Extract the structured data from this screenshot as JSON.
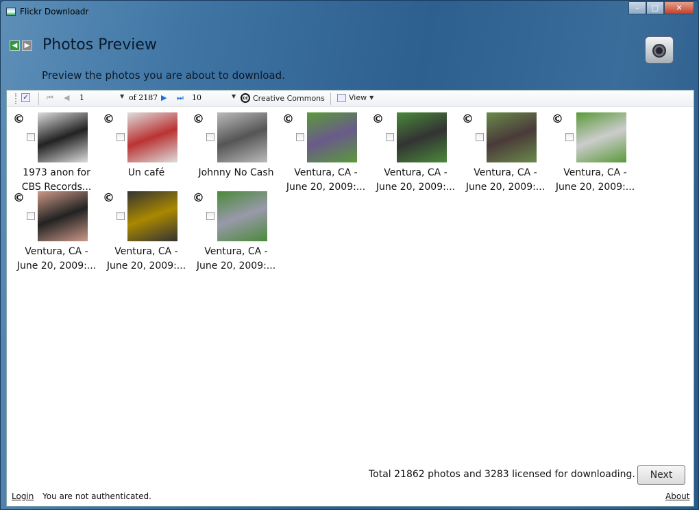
{
  "window": {
    "title": "Flickr Downloadr",
    "min": "–",
    "max": "□",
    "close": "✕"
  },
  "header": {
    "title": "Photos Preview",
    "subtitle": "Preview the photos you are about to download."
  },
  "toolbar": {
    "page": "1",
    "of_label": "of 2187",
    "per_page": "10",
    "license_label": "Creative Commons",
    "view_label": "View",
    "cc_glyph": "cc"
  },
  "photos": [
    {
      "caption": [
        "1973 anon for",
        "CBS Records..."
      ],
      "colors": [
        "#222",
        "#ddd"
      ],
      "license": "©"
    },
    {
      "caption": [
        "Un café",
        ""
      ],
      "colors": [
        "#b33",
        "#ddd"
      ],
      "license": "©"
    },
    {
      "caption": [
        "Johnny No Cash",
        ""
      ],
      "colors": [
        "#555",
        "#bbb"
      ],
      "license": "©"
    },
    {
      "caption": [
        "Ventura, CA -",
        "June 20, 2009:..."
      ],
      "colors": [
        "#6a5a8a",
        "#5a9a3a"
      ],
      "license": "©"
    },
    {
      "caption": [
        "Ventura, CA -",
        "June 20, 2009:..."
      ],
      "colors": [
        "#333",
        "#4a8a3a"
      ],
      "license": "©"
    },
    {
      "caption": [
        "Ventura, CA -",
        "June 20, 2009:..."
      ],
      "colors": [
        "#4a3a3a",
        "#6a8a4a"
      ],
      "license": "©"
    },
    {
      "caption": [
        "Ventura, CA -",
        "June 20, 2009:..."
      ],
      "colors": [
        "#ccc",
        "#5a9a3a"
      ],
      "license": "©"
    },
    {
      "caption": [
        "Ventura, CA -",
        "June 20, 2009:..."
      ],
      "colors": [
        "#222",
        "#c98"
      ],
      "license": "©"
    },
    {
      "caption": [
        "Ventura, CA -",
        "June 20, 2009:..."
      ],
      "colors": [
        "#a80",
        "#333"
      ],
      "license": "©"
    },
    {
      "caption": [
        "Ventura, CA -",
        "June 20, 2009:..."
      ],
      "colors": [
        "#99a",
        "#4a8a3a"
      ],
      "license": "©"
    }
  ],
  "footer": {
    "total_text": "Total 21862 photos and 3283 licensed for downloading.",
    "next_label": "Next"
  },
  "status": {
    "login_label": "Login",
    "auth_text": "You are not authenticated.",
    "about_label": "About"
  }
}
